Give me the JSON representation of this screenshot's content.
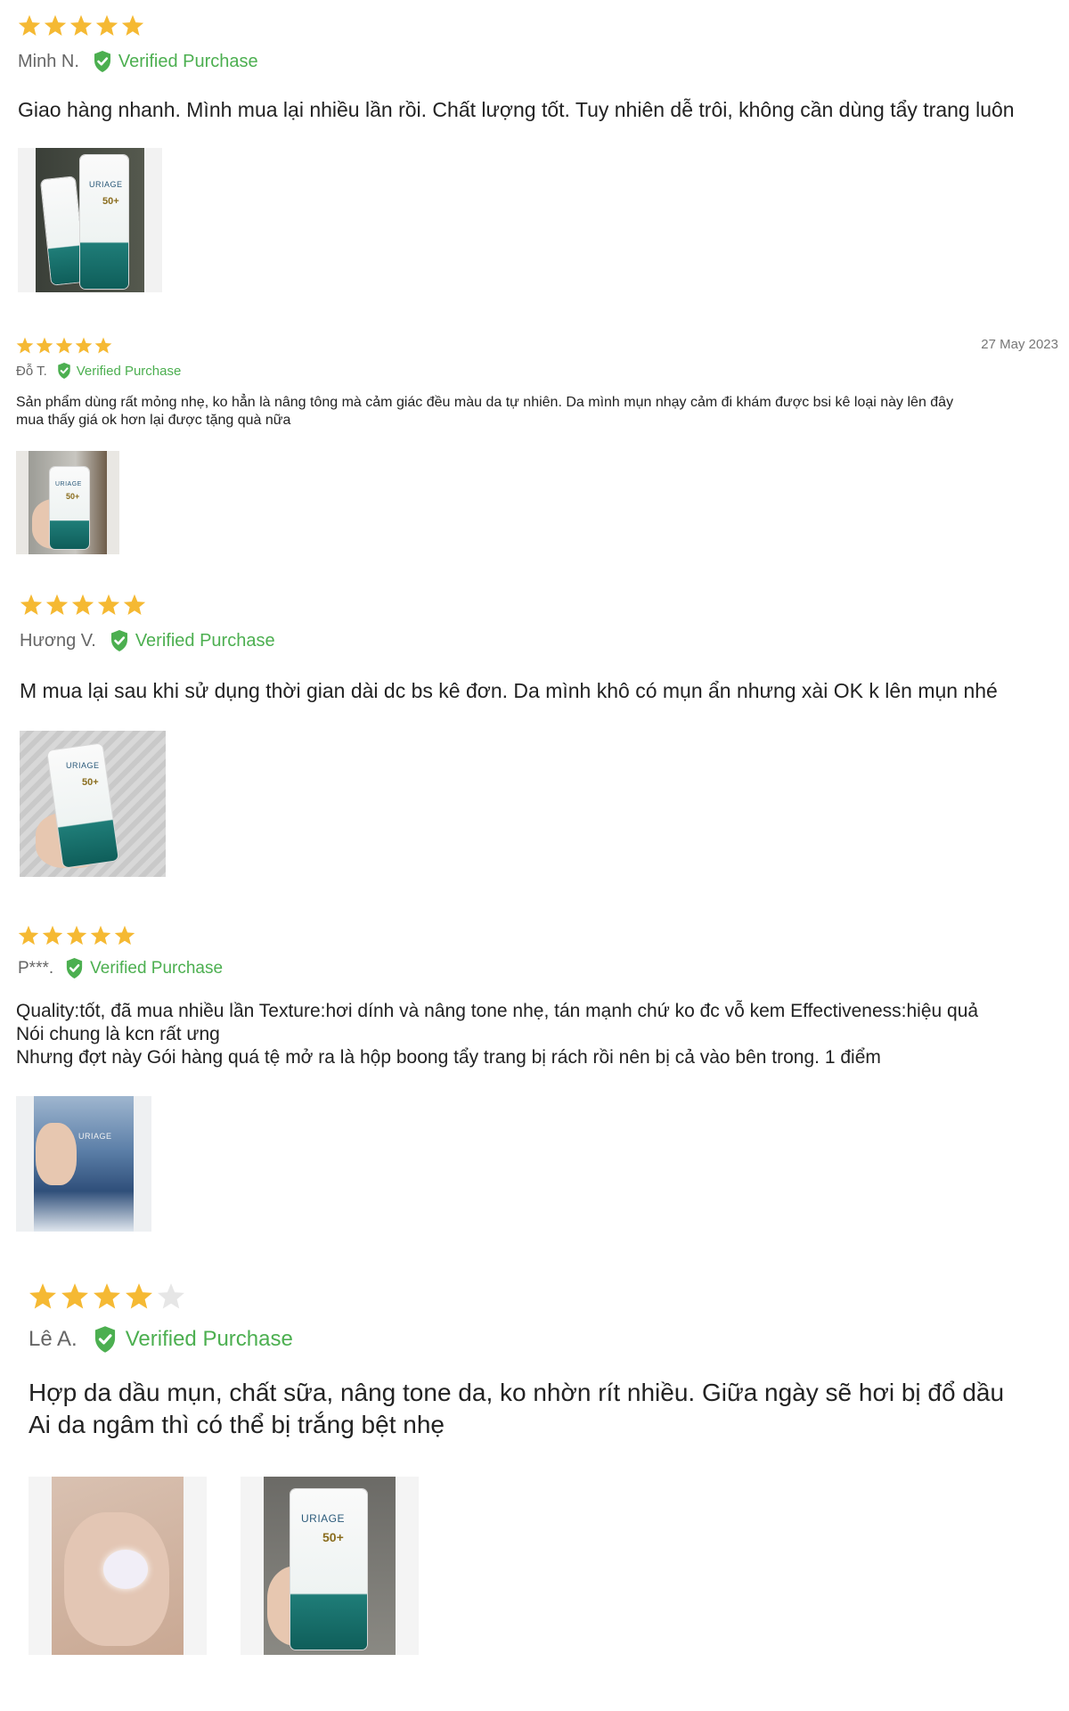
{
  "colors": {
    "star_fill": "#f5b933",
    "star_empty": "#e6e6e6",
    "verified_green": "#4caf50"
  },
  "icons": {
    "star": "star-icon",
    "verified": "check-shield-icon"
  },
  "reviews": [
    {
      "rating": 5,
      "author": "Minh N.",
      "verified_label": "Verified Purchase",
      "date": "",
      "text": "Giao hàng nhanh. Mình mua lại nhiều lần rồi. Chất lượng tốt. Tuy nhiên dễ trôi, không cần dùng tẩy trang luôn",
      "photos": [
        {
          "brand": "URIAGE",
          "spf": "50+"
        }
      ]
    },
    {
      "rating": 5,
      "author": "Đỗ T.",
      "verified_label": "Verified Purchase",
      "date": "27 May 2023",
      "text": "Sản phẩm dùng rất mỏng nhẹ, ko hẳn là nâng tông mà cảm giác đều màu da tự nhiên. Da mình mụn nhạy cảm đi khám được bsi kê loại này lên đây\nmua thấy giá ok hơn lại được tặng quà nữa",
      "photos": [
        {
          "brand": "URIAGE",
          "spf": "50+"
        }
      ]
    },
    {
      "rating": 5,
      "author": "Hương V.",
      "verified_label": "Verified Purchase",
      "date": "",
      "text": "M mua lại sau khi sử dụng thời gian dài dc bs kê đơn. Da mình khô có mụn ẩn nhưng xài OK k lên mụn nhé",
      "photos": [
        {
          "brand": "URIAGE",
          "spf": "50+"
        }
      ]
    },
    {
      "rating": 5,
      "author": "P***.",
      "verified_label": "Verified Purchase",
      "date": "",
      "text": "Quality:tốt, đã mua nhiều lần Texture:hơi dính và nâng tone nhẹ, tán mạnh chứ ko đc vỗ kem Effectiveness:hiệu quả\nNói chung là kcn rất ưng\nNhưng đợt này Gói hàng quá tệ mở ra là hộp boong tẩy trang bị rách rồi nên bị cả vào bên trong. 1 điểm",
      "photos": [
        {
          "brand": "URIAGE",
          "spf": ""
        }
      ]
    },
    {
      "rating": 4,
      "author": "Lê A.",
      "verified_label": "Verified Purchase",
      "date": "",
      "text": "Hợp da dầu mụn, chất sữa, nâng tone da, ko nhờn rít nhiều. Giữa ngày sẽ hơi bị đổ dầu\nAi da ngâm thì có thể bị trắng bệt nhẹ",
      "photos": [
        {
          "brand": "",
          "spf": ""
        },
        {
          "brand": "URIAGE",
          "spf": "50+"
        }
      ]
    }
  ]
}
